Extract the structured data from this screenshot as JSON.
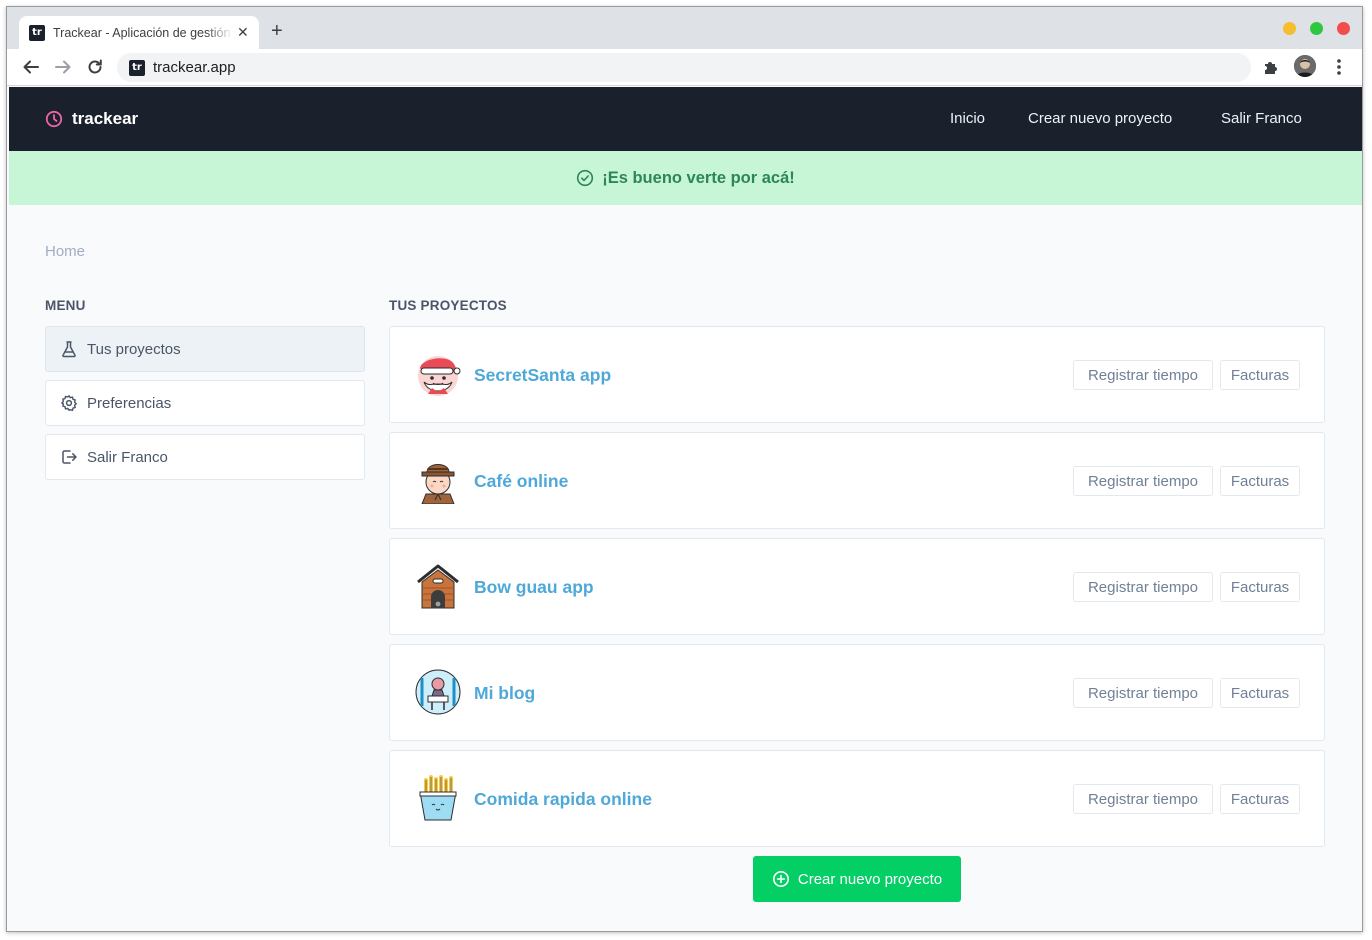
{
  "browser": {
    "tab_title": "Trackear - Aplicación de gestión",
    "favicon_text": "tr",
    "url": "trackear.app",
    "close_glyph": "✕",
    "newtab_glyph": "+"
  },
  "header": {
    "brand": "trackear",
    "nav": [
      "Inicio",
      "Crear nuevo proyecto",
      "Salir Franco"
    ]
  },
  "flash": {
    "message": "¡Es bueno verte por acá!"
  },
  "breadcrumb": "Home",
  "menu": {
    "title": "MENU",
    "items": [
      {
        "label": "Tus proyectos",
        "icon": "flask-icon",
        "active": true
      },
      {
        "label": "Preferencias",
        "icon": "gear-icon",
        "active": false
      },
      {
        "label": "Salir Franco",
        "icon": "logout-icon",
        "active": false
      }
    ]
  },
  "projects": {
    "title": "TUS PROYECTOS",
    "items": [
      {
        "name": "SecretSanta app",
        "icon": "santa-avatar-icon"
      },
      {
        "name": "Café online",
        "icon": "explorer-avatar-icon"
      },
      {
        "name": "Bow guau app",
        "icon": "doghouse-icon"
      },
      {
        "name": "Mi blog",
        "icon": "blog-avatar-icon"
      },
      {
        "name": "Comida rapida online",
        "icon": "fries-icon"
      }
    ],
    "register_label": "Registrar tiempo",
    "invoices_label": "Facturas"
  },
  "create_button": {
    "label": "Crear nuevo proyecto",
    "icon": "plus-circle-icon"
  },
  "colors": {
    "header_bg": "#1a202c",
    "brand_accent": "#ed64a6",
    "flash_bg": "#c6f6d5",
    "flash_text": "#2f855a",
    "project_link": "#4ea9d8",
    "create_button_bg": "#03cf65"
  }
}
